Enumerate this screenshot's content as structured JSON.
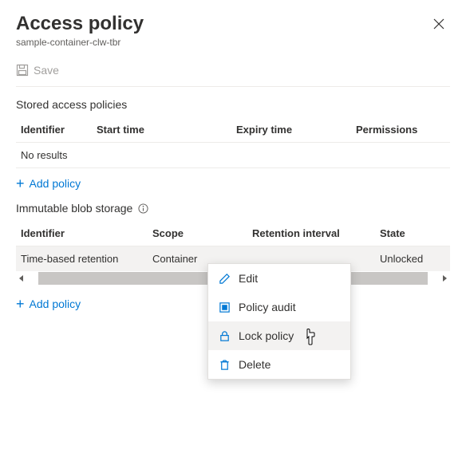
{
  "header": {
    "title": "Access policy",
    "subtitle": "sample-container-clw-tbr"
  },
  "toolbar": {
    "save_label": "Save"
  },
  "stored": {
    "section_label": "Stored access policies",
    "columns": {
      "identifier": "Identifier",
      "start": "Start time",
      "expiry": "Expiry time",
      "permissions": "Permissions"
    },
    "no_results": "No results",
    "add_label": "Add policy"
  },
  "immutable": {
    "section_label": "Immutable blob storage",
    "columns": {
      "identifier": "Identifier",
      "scope": "Scope",
      "retention": "Retention interval",
      "state": "State"
    },
    "rows": [
      {
        "identifier": "Time-based retention",
        "scope": "Container",
        "retention": "",
        "state": "Unlocked"
      }
    ],
    "add_label": "Add policy"
  },
  "context_menu": {
    "edit": "Edit",
    "audit": "Policy audit",
    "lock": "Lock policy",
    "delete": "Delete"
  }
}
